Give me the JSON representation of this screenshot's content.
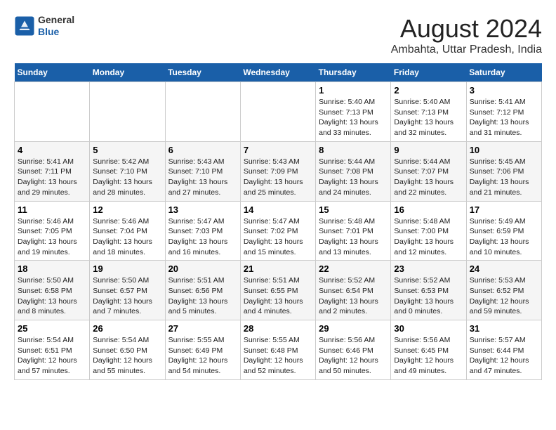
{
  "header": {
    "logo_general": "General",
    "logo_blue": "Blue",
    "main_title": "August 2024",
    "sub_title": "Ambahta, Uttar Pradesh, India"
  },
  "weekdays": [
    "Sunday",
    "Monday",
    "Tuesday",
    "Wednesday",
    "Thursday",
    "Friday",
    "Saturday"
  ],
  "weeks": [
    [
      {
        "day": "",
        "info": ""
      },
      {
        "day": "",
        "info": ""
      },
      {
        "day": "",
        "info": ""
      },
      {
        "day": "",
        "info": ""
      },
      {
        "day": "1",
        "info": "Sunrise: 5:40 AM\nSunset: 7:13 PM\nDaylight: 13 hours\nand 33 minutes."
      },
      {
        "day": "2",
        "info": "Sunrise: 5:40 AM\nSunset: 7:13 PM\nDaylight: 13 hours\nand 32 minutes."
      },
      {
        "day": "3",
        "info": "Sunrise: 5:41 AM\nSunset: 7:12 PM\nDaylight: 13 hours\nand 31 minutes."
      }
    ],
    [
      {
        "day": "4",
        "info": "Sunrise: 5:41 AM\nSunset: 7:11 PM\nDaylight: 13 hours\nand 29 minutes."
      },
      {
        "day": "5",
        "info": "Sunrise: 5:42 AM\nSunset: 7:10 PM\nDaylight: 13 hours\nand 28 minutes."
      },
      {
        "day": "6",
        "info": "Sunrise: 5:43 AM\nSunset: 7:10 PM\nDaylight: 13 hours\nand 27 minutes."
      },
      {
        "day": "7",
        "info": "Sunrise: 5:43 AM\nSunset: 7:09 PM\nDaylight: 13 hours\nand 25 minutes."
      },
      {
        "day": "8",
        "info": "Sunrise: 5:44 AM\nSunset: 7:08 PM\nDaylight: 13 hours\nand 24 minutes."
      },
      {
        "day": "9",
        "info": "Sunrise: 5:44 AM\nSunset: 7:07 PM\nDaylight: 13 hours\nand 22 minutes."
      },
      {
        "day": "10",
        "info": "Sunrise: 5:45 AM\nSunset: 7:06 PM\nDaylight: 13 hours\nand 21 minutes."
      }
    ],
    [
      {
        "day": "11",
        "info": "Sunrise: 5:46 AM\nSunset: 7:05 PM\nDaylight: 13 hours\nand 19 minutes."
      },
      {
        "day": "12",
        "info": "Sunrise: 5:46 AM\nSunset: 7:04 PM\nDaylight: 13 hours\nand 18 minutes."
      },
      {
        "day": "13",
        "info": "Sunrise: 5:47 AM\nSunset: 7:03 PM\nDaylight: 13 hours\nand 16 minutes."
      },
      {
        "day": "14",
        "info": "Sunrise: 5:47 AM\nSunset: 7:02 PM\nDaylight: 13 hours\nand 15 minutes."
      },
      {
        "day": "15",
        "info": "Sunrise: 5:48 AM\nSunset: 7:01 PM\nDaylight: 13 hours\nand 13 minutes."
      },
      {
        "day": "16",
        "info": "Sunrise: 5:48 AM\nSunset: 7:00 PM\nDaylight: 13 hours\nand 12 minutes."
      },
      {
        "day": "17",
        "info": "Sunrise: 5:49 AM\nSunset: 6:59 PM\nDaylight: 13 hours\nand 10 minutes."
      }
    ],
    [
      {
        "day": "18",
        "info": "Sunrise: 5:50 AM\nSunset: 6:58 PM\nDaylight: 13 hours\nand 8 minutes."
      },
      {
        "day": "19",
        "info": "Sunrise: 5:50 AM\nSunset: 6:57 PM\nDaylight: 13 hours\nand 7 minutes."
      },
      {
        "day": "20",
        "info": "Sunrise: 5:51 AM\nSunset: 6:56 PM\nDaylight: 13 hours\nand 5 minutes."
      },
      {
        "day": "21",
        "info": "Sunrise: 5:51 AM\nSunset: 6:55 PM\nDaylight: 13 hours\nand 4 minutes."
      },
      {
        "day": "22",
        "info": "Sunrise: 5:52 AM\nSunset: 6:54 PM\nDaylight: 13 hours\nand 2 minutes."
      },
      {
        "day": "23",
        "info": "Sunrise: 5:52 AM\nSunset: 6:53 PM\nDaylight: 13 hours\nand 0 minutes."
      },
      {
        "day": "24",
        "info": "Sunrise: 5:53 AM\nSunset: 6:52 PM\nDaylight: 12 hours\nand 59 minutes."
      }
    ],
    [
      {
        "day": "25",
        "info": "Sunrise: 5:54 AM\nSunset: 6:51 PM\nDaylight: 12 hours\nand 57 minutes."
      },
      {
        "day": "26",
        "info": "Sunrise: 5:54 AM\nSunset: 6:50 PM\nDaylight: 12 hours\nand 55 minutes."
      },
      {
        "day": "27",
        "info": "Sunrise: 5:55 AM\nSunset: 6:49 PM\nDaylight: 12 hours\nand 54 minutes."
      },
      {
        "day": "28",
        "info": "Sunrise: 5:55 AM\nSunset: 6:48 PM\nDaylight: 12 hours\nand 52 minutes."
      },
      {
        "day": "29",
        "info": "Sunrise: 5:56 AM\nSunset: 6:46 PM\nDaylight: 12 hours\nand 50 minutes."
      },
      {
        "day": "30",
        "info": "Sunrise: 5:56 AM\nSunset: 6:45 PM\nDaylight: 12 hours\nand 49 minutes."
      },
      {
        "day": "31",
        "info": "Sunrise: 5:57 AM\nSunset: 6:44 PM\nDaylight: 12 hours\nand 47 minutes."
      }
    ]
  ]
}
